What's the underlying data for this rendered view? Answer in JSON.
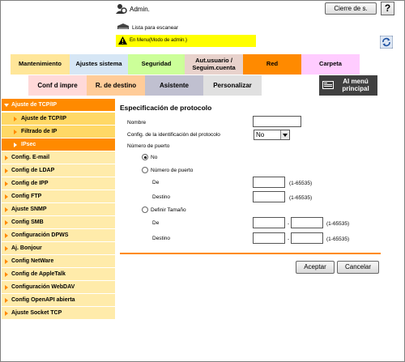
{
  "header": {
    "admin_label": "Admin.",
    "logout_label": "Cierre de s.",
    "help_label": "?",
    "scan_list_label": "Lista para escanear",
    "admin_mode_label": "En Menu(Modo de admin.)"
  },
  "tabs_row1": [
    {
      "label": "Mantenimiento",
      "color": "#ffe699"
    },
    {
      "label": "Ajustes sistema",
      "color": "#d6e6f5"
    },
    {
      "label": "Seguridad",
      "color": "#ccff99"
    },
    {
      "label": "Aut.usuario / Seguim.cuenta",
      "color": "#e8d2cc"
    },
    {
      "label": "Red",
      "color": "#ff8a00"
    },
    {
      "label": "Carpeta",
      "color": "#ffccff"
    }
  ],
  "tabs_row2": [
    {
      "label": "Conf d impre",
      "color": "#ffd9d9"
    },
    {
      "label": "R. de destino",
      "color": "#ffcc99"
    },
    {
      "label": "Asistente",
      "color": "#c0c0d0"
    },
    {
      "label": "Personalizar",
      "color": "#e0e0e0"
    },
    {
      "label": "Al menú principal",
      "color": "#404040"
    }
  ],
  "sidebar": {
    "items": [
      {
        "label": "Ajuste de TCP/IP",
        "kind": "head"
      },
      {
        "label": "Ajuste de TCP/IP",
        "kind": "sub"
      },
      {
        "label": "Filtrado de IP",
        "kind": "sub"
      },
      {
        "label": "IPsec",
        "kind": "sub-active"
      },
      {
        "label": "Config. E-mail",
        "kind": "item"
      },
      {
        "label": "Config de LDAP",
        "kind": "item"
      },
      {
        "label": "Config de IPP",
        "kind": "item"
      },
      {
        "label": "Config FTP",
        "kind": "item"
      },
      {
        "label": "Ajuste SNMP",
        "kind": "item"
      },
      {
        "label": "Config SMB",
        "kind": "item"
      },
      {
        "label": "Configuración DPWS",
        "kind": "item"
      },
      {
        "label": "Aj. Bonjour",
        "kind": "item"
      },
      {
        "label": "Config NetWare",
        "kind": "item"
      },
      {
        "label": "Config de AppleTalk",
        "kind": "item"
      },
      {
        "label": "Configuración WebDAV",
        "kind": "item"
      },
      {
        "label": "Config OpenAPI abierta",
        "kind": "item"
      },
      {
        "label": "Ajuste Socket TCP",
        "kind": "item"
      }
    ]
  },
  "main": {
    "title": "Especificación de protocolo",
    "name_label": "Nombre",
    "name_value": "",
    "protocol_id_label": "Config. de la identificación del protocolo",
    "protocol_id_value": "No",
    "port_number_label": "Número de puerto",
    "radio_no_label": "No",
    "radio_port_label": "Número de puerto",
    "from_label": "De",
    "to_label": "Destino",
    "range_hint": "(1-65535)",
    "radio_size_label": "Definir Tamaño",
    "dash": "-",
    "accept_label": "Aceptar",
    "cancel_label": "Cancelar"
  },
  "colors": {
    "accent": "#ff8a00",
    "sidebar_item": "#ffebaa",
    "sidebar_sub": "#ffd866",
    "admin_bar": "#ffff00"
  }
}
